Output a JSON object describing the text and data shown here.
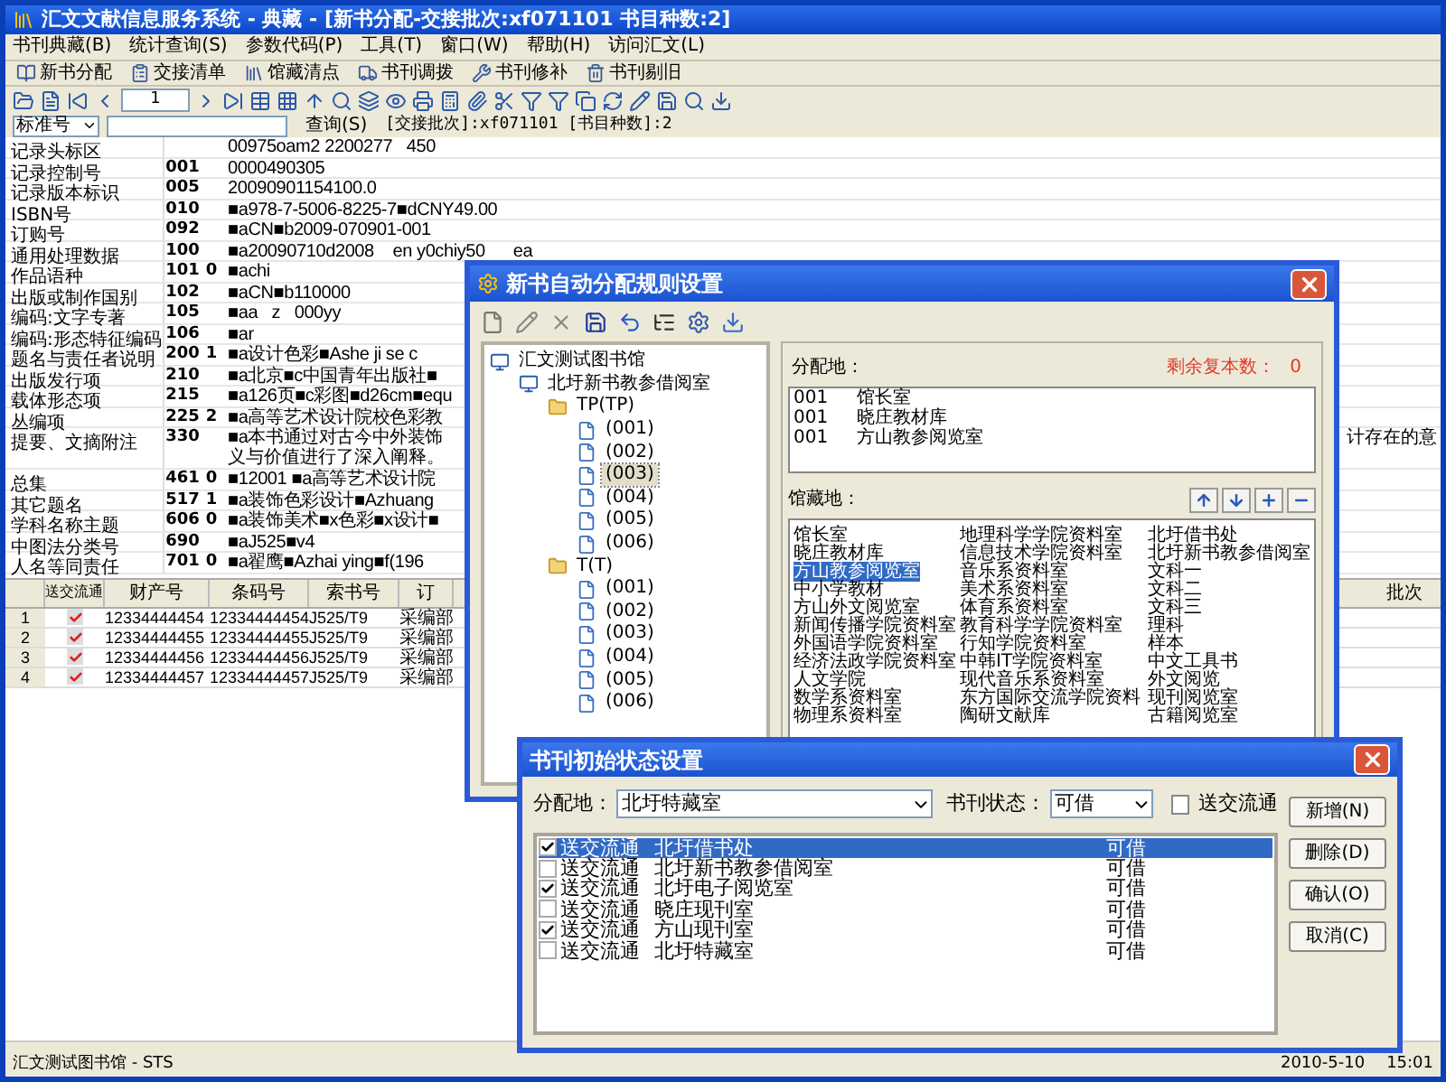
{
  "window": {
    "title": "汇文文献信息服务系统 - 典藏 - [新书分配-交接批次:xf071101 书目种数:2]"
  },
  "menu": [
    "书刊典藏(B)",
    "统计查询(S)",
    "参数代码(P)",
    "工具(T)",
    "窗口(W)",
    "帮助(H)",
    "访问汇文(L)"
  ],
  "toolbar": [
    "新书分配",
    "交接清单",
    "馆藏清点",
    "书刊调拨",
    "书刊修补",
    "书刊剔旧"
  ],
  "nav": {
    "page": "1"
  },
  "search": {
    "field": "标准号",
    "button": "查询(S)",
    "info": "[交接批次]:xf071101 [书目种数]:2"
  },
  "record": [
    {
      "label": "记录头标区",
      "value": "00975oam2 2200277   450"
    },
    {
      "label": "记录控制号",
      "tag": "001",
      "value": "0000490305"
    },
    {
      "label": "记录版本标识",
      "tag": "005",
      "value": "20090901154100.0"
    },
    {
      "label": "ISBN号",
      "tag": "010",
      "value": "■a978-7-5006-8225-7■dCNY49.00"
    },
    {
      "label": "订购号",
      "tag": "092",
      "value": "■aCN■b2009-070901-001"
    },
    {
      "label": "通用处理数据",
      "tag": "100",
      "value": "■a20090710d2008    en y0chiy50      ea"
    },
    {
      "label": "作品语种",
      "tag": "101",
      "ind": "0",
      "value": "■achi"
    },
    {
      "label": "出版或制作国别",
      "tag": "102",
      "value": "■aCN■b110000"
    },
    {
      "label": "编码:文字专著",
      "tag": "105",
      "value": "■aa   z   000yy"
    },
    {
      "label": "编码:形态特征编码",
      "tag": "106",
      "value": "■ar"
    },
    {
      "label": "题名与责任者说明",
      "tag": "200",
      "ind": "1",
      "value": "■a设计色彩■Ashe ji se c"
    },
    {
      "label": "出版发行项",
      "tag": "210",
      "value": "■a北京■c中国青年出版社■"
    },
    {
      "label": "载体形态项",
      "tag": "215",
      "value": "■a126页■c彩图■d26cm■equ"
    },
    {
      "label": "丛编项",
      "tag": "225",
      "ind": "2",
      "value": "■a高等艺术设计院校色彩教"
    },
    {
      "label": "提要、文摘附注",
      "tag": "330",
      "value": "■a本书通过对古今中外装饰",
      "value_line_2": "义与价值进行了深入阐释。",
      "tail": "计存在的意"
    },
    {
      "label": "总集",
      "tag": "461",
      "ind": "0",
      "value": "■12001 ■a高等艺术设计院"
    },
    {
      "label": "其它题名",
      "tag": "517",
      "ind": "1",
      "value": "■a装饰色彩设计■Azhuang"
    },
    {
      "label": "学科名称主题",
      "tag": "606",
      "ind": "0",
      "value": "■a装饰美术■x色彩■x设计■"
    },
    {
      "label": "中图法分类号",
      "tag": "690",
      "value": "■aJ525■v4"
    },
    {
      "label": "人名等同责任",
      "tag": "701",
      "ind": "0",
      "value": "■a翟鹰■Azhai ying■f(196"
    }
  ],
  "table": {
    "checkbox_column": "送交流通",
    "columns": [
      "财产号",
      "条码号",
      "索书号",
      "订"
    ],
    "tail_column": "批次",
    "rows": [
      {
        "no": "1",
        "checked": true,
        "cells": [
          "12334444454",
          "12334444454",
          "J525/T9",
          "采编部"
        ]
      },
      {
        "no": "2",
        "checked": true,
        "cells": [
          "12334444455",
          "12334444455",
          "J525/T9",
          "采编部"
        ]
      },
      {
        "no": "3",
        "checked": true,
        "cells": [
          "12334444456",
          "12334444456",
          "J525/T9",
          "采编部"
        ]
      },
      {
        "no": "4",
        "checked": true,
        "cells": [
          "12334444457",
          "12334444457",
          "J525/T9",
          "采编部"
        ]
      }
    ]
  },
  "status_bar": {
    "left": "汇文测试图书馆 - STS",
    "date": "2010-5-10",
    "time": "15:01"
  },
  "rule_dialog": {
    "title": "新书自动分配规则设置",
    "tree": {
      "label": "汇文测试图书馆",
      "children": [
        {
          "label": "北圩新书教参借阅室",
          "children": [
            {
              "label": "TP(TP)",
              "children": [
                {
                  "label": "(001)",
                  "selected": false
                },
                {
                  "label": "(002)",
                  "selected": false
                },
                {
                  "label": "(003)",
                  "selected": true
                },
                {
                  "label": "(004)",
                  "selected": false
                },
                {
                  "label": "(005)",
                  "selected": false
                },
                {
                  "label": "(006)",
                  "selected": false
                }
              ]
            },
            {
              "label": "T(T)",
              "children": [
                {
                  "label": "(001)",
                  "selected": false
                },
                {
                  "label": "(002)",
                  "selected": false
                },
                {
                  "label": "(003)",
                  "selected": false
                },
                {
                  "label": "(004)",
                  "selected": false
                },
                {
                  "label": "(005)",
                  "selected": false
                },
                {
                  "label": "(006)",
                  "selected": false
                }
              ]
            }
          ]
        }
      ]
    },
    "assign_label": "分配地：",
    "remaining_label": "剩余复本数：",
    "remaining": "0",
    "assigned": [
      {
        "code": "001",
        "name": "馆长室"
      },
      {
        "code": "001",
        "name": "晓庄教材库"
      },
      {
        "code": "001",
        "name": "方山教参阅览室"
      }
    ],
    "holdings_label": "馆藏地：",
    "holdings": [
      [
        {
          "name": "馆长室",
          "selected": false
        },
        {
          "name": "地理科学学院资料室",
          "selected": false
        },
        {
          "name": "北圩借书处",
          "selected": false
        }
      ],
      [
        {
          "name": "晓庄教材库",
          "selected": false
        },
        {
          "name": "信息技术学院资料室",
          "selected": false
        },
        {
          "name": "北圩新书教参借阅室",
          "selected": false
        }
      ],
      [
        {
          "name": "方山教参阅览室",
          "selected": true
        },
        {
          "name": "音乐系资料室",
          "selected": false
        },
        {
          "name": "文科一",
          "selected": false
        }
      ],
      [
        {
          "name": "中小学教材",
          "selected": false
        },
        {
          "name": "美术系资料室",
          "selected": false
        },
        {
          "name": "文科二",
          "selected": false
        }
      ],
      [
        {
          "name": "方山外文阅览室",
          "selected": false
        },
        {
          "name": "体育系资料室",
          "selected": false
        },
        {
          "name": "文科三",
          "selected": false
        }
      ],
      [
        {
          "name": "新闻传播学院资料室",
          "selected": false
        },
        {
          "name": "教育科学学院资料室",
          "selected": false
        },
        {
          "name": "理科",
          "selected": false
        }
      ],
      [
        {
          "name": "外国语学院资料室",
          "selected": false
        },
        {
          "name": "行知学院资料室",
          "selected": false
        },
        {
          "name": "样本",
          "selected": false
        }
      ],
      [
        {
          "name": "经济法政学院资料室",
          "selected": false
        },
        {
          "name": "中韩IT学院资料室",
          "selected": false
        },
        {
          "name": "中文工具书",
          "selected": false
        }
      ],
      [
        {
          "name": "人文学院",
          "selected": false
        },
        {
          "name": "现代音乐系资料室",
          "selected": false
        },
        {
          "name": "外文阅览",
          "selected": false
        }
      ],
      [
        {
          "name": "数学系资料室",
          "selected": false
        },
        {
          "name": "东方国际交流学院资料",
          "selected": false
        },
        {
          "name": "现刊阅览室",
          "selected": false
        }
      ],
      [
        {
          "name": "物理系资料室",
          "selected": false
        },
        {
          "name": "陶研文献库",
          "selected": false
        },
        {
          "name": "古籍阅览室",
          "selected": false
        }
      ]
    ]
  },
  "status_dialog": {
    "title": "书刊初始状态设置",
    "assign_label": "分配地：",
    "assign_value": "北圩特藏室",
    "state_label": "书刊状态：",
    "state_value": "可借",
    "circulate": {
      "label": "送交流通",
      "checked": false
    },
    "rows": [
      {
        "checked": true,
        "selected": true,
        "type": "送交流通",
        "place": "北圩借书处",
        "state": "可借"
      },
      {
        "checked": false,
        "selected": false,
        "type": "送交流通",
        "place": "北圩新书教参借阅室",
        "state": "可借"
      },
      {
        "checked": true,
        "selected": false,
        "type": "送交流通",
        "place": "北圩电子阅览室",
        "state": "可借"
      },
      {
        "checked": false,
        "selected": false,
        "type": "送交流通",
        "place": "晓庄现刊室",
        "state": "可借"
      },
      {
        "checked": true,
        "selected": false,
        "type": "送交流通",
        "place": "方山现刊室",
        "state": "可借"
      },
      {
        "checked": false,
        "selected": false,
        "type": "送交流通",
        "place": "北圩特藏室",
        "state": "可借"
      }
    ],
    "buttons": [
      "新增(N)",
      "删除(D)",
      "确认(O)",
      "取消(C)"
    ]
  }
}
